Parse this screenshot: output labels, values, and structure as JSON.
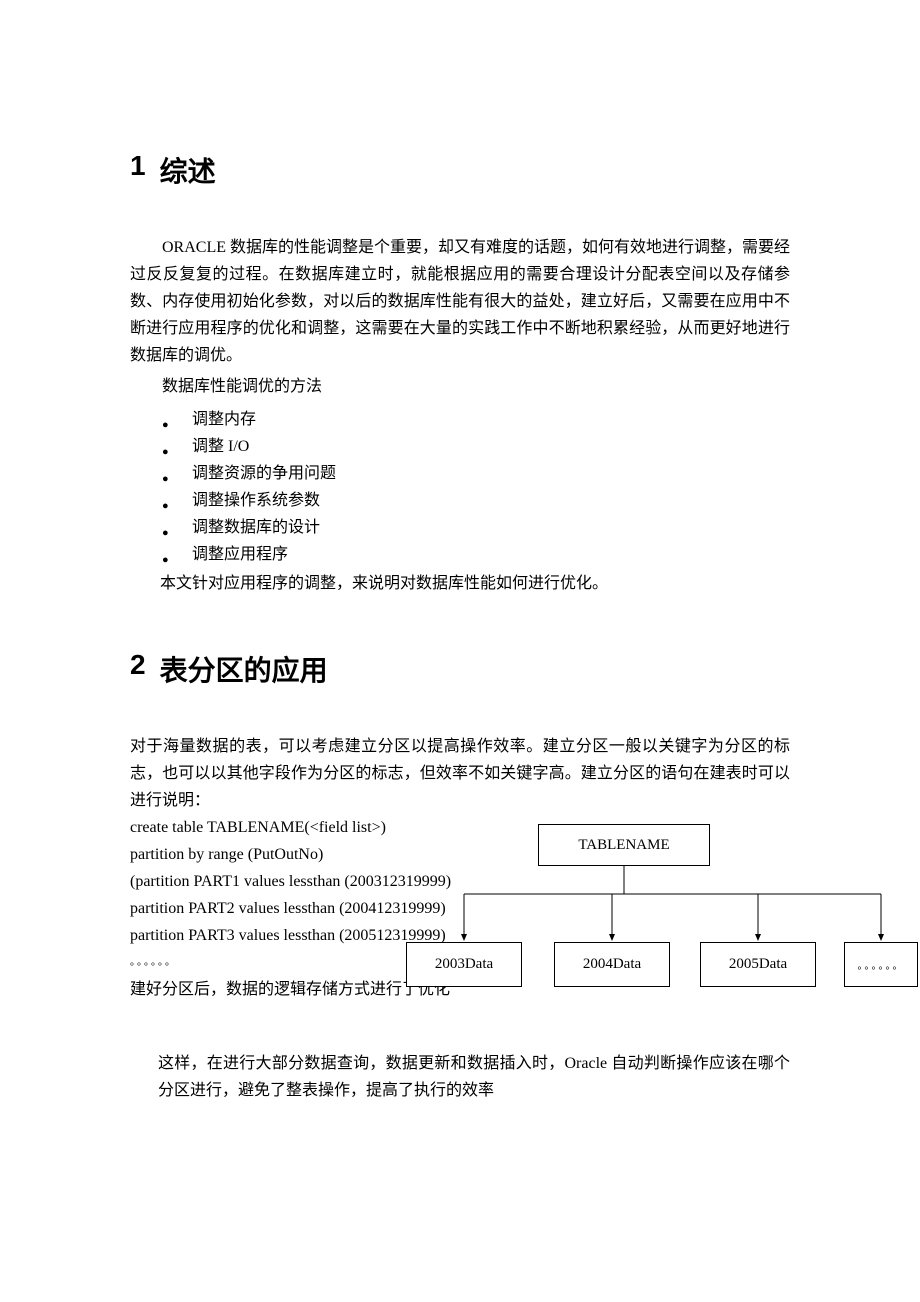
{
  "section1": {
    "number": "1",
    "title": "综述",
    "para1": "ORACLE 数据库的性能调整是个重要，却又有难度的话题，如何有效地进行调整，需要经过反反复复的过程。在数据库建立时，就能根据应用的需要合理设计分配表空间以及存储参数、内存使用初始化参数，对以后的数据库性能有很大的益处，建立好后，又需要在应用中不断进行应用程序的优化和调整，这需要在大量的实践工作中不断地积累经验，从而更好地进行数据库的调优。",
    "para2": "数据库性能调优的方法",
    "bullets": [
      "调整内存",
      "调整 I/O",
      "调整资源的争用问题",
      "调整操作系统参数",
      "调整数据库的设计",
      "调整应用程序"
    ],
    "closing": "本文针对应用程序的调整，来说明对数据库性能如何进行优化。"
  },
  "section2": {
    "number": "2",
    "title": "表分区的应用",
    "para1": "对于海量数据的表，可以考虑建立分区以提高操作效率。建立分区一般以关键字为分区的标志，也可以以其他字段作为分区的标志，但效率不如关键字高。建立分区的语句在建表时可以进行说明：",
    "code": [
      "create table TABLENAME(<field list>)",
      "partition by range (PutOutNo)",
      "(partition PART1 values lessthan (200312319999)",
      "partition PART2 values lessthan (200412319999)",
      "partition PART3 values lessthan (200512319999)",
      "。。。。。。"
    ],
    "after_code": "建好分区后，数据的逻辑存储方式进行了优化",
    "diagram": {
      "root": "TABLENAME",
      "children": [
        "2003Data",
        "2004Data",
        "2005Data",
        "。。。。。。"
      ]
    },
    "final": "这样，在进行大部分数据查询，数据更新和数据插入时，Oracle 自动判断操作应该在哪个分区进行，避免了整表操作，提高了执行的效率"
  }
}
